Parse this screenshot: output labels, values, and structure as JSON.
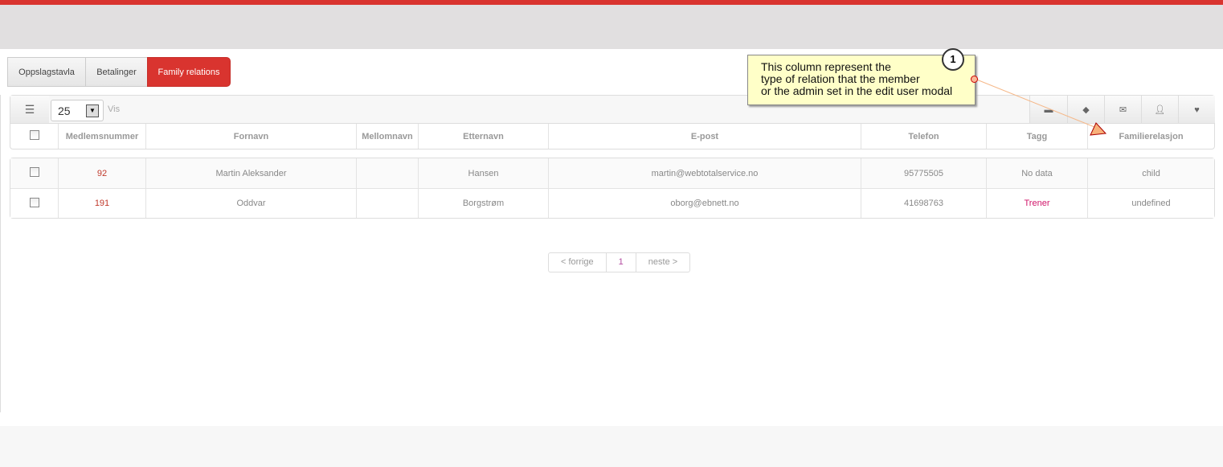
{
  "tabs": [
    {
      "label": "Oppslagstavla"
    },
    {
      "label": "Betalinger"
    },
    {
      "label": "Family relations"
    }
  ],
  "toolbar": {
    "page_size": "25",
    "show_label": "Vis",
    "icons": [
      "message-icon",
      "tag-icon",
      "mail-icon",
      "user-icon",
      "heart-icon"
    ]
  },
  "columns": [
    "Medlemsnummer",
    "Fornavn",
    "Mellomnavn",
    "Etternavn",
    "E-post",
    "Telefon",
    "Tagg",
    "Familierelasjon"
  ],
  "rows": [
    {
      "number": "92",
      "first": "Martin Aleksander",
      "middle": "",
      "last": "Hansen",
      "email": "martin@webtotalservice.no",
      "phone": "95775505",
      "tag": "No data",
      "relation": "child"
    },
    {
      "number": "191",
      "first": "Oddvar",
      "middle": "",
      "last": "Borgstrøm",
      "email": "oborg@ebnett.no",
      "phone": "41698763",
      "tag": "Trener",
      "relation": "undefined"
    }
  ],
  "pagination": {
    "prev": "< forrige",
    "page": "1",
    "next": "neste >"
  },
  "annotation": {
    "number": "1",
    "lines": [
      "This column represent the",
      "type of relation that the member",
      "or the admin set in the edit user modal"
    ]
  },
  "colors": {
    "accent": "#d9342f",
    "tag": "#d0166a",
    "note": "#ffffc8"
  }
}
